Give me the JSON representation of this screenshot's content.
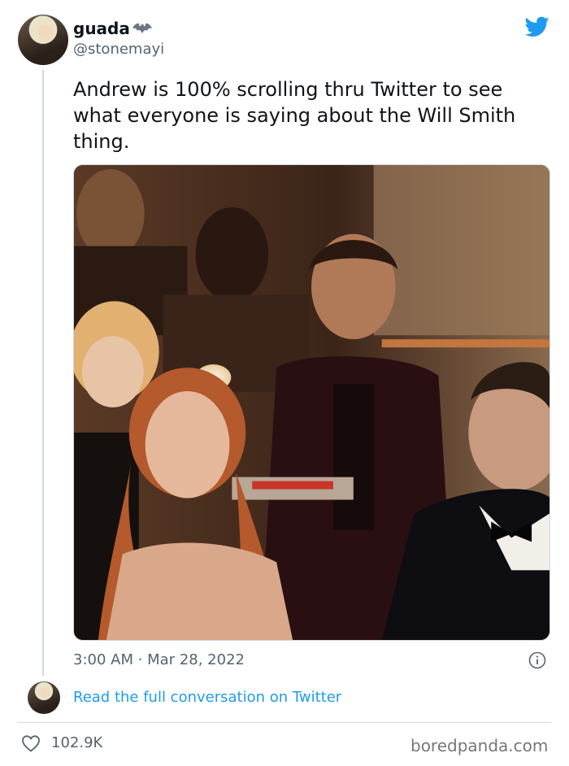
{
  "author": {
    "display_name": "guada",
    "handle": "@stonemayi",
    "badge_icon": "batman-icon",
    "avatar": "user-avatar"
  },
  "platform_icon": "twitter-bird-icon",
  "tweet": {
    "text": "Andrew is 100% scrolling thru Twitter to see what everyone is saying about the Will Smith thing.",
    "timestamp": "3:00 AM · Mar 28, 2022"
  },
  "footer": {
    "read_link": "Read the full conversation on Twitter",
    "likes": "102.9K",
    "watermark": "boredpanda.com"
  },
  "colors": {
    "link": "#1d9bf0",
    "secondary_text": "#536471",
    "twitter_blue": "#1d9bf0"
  }
}
